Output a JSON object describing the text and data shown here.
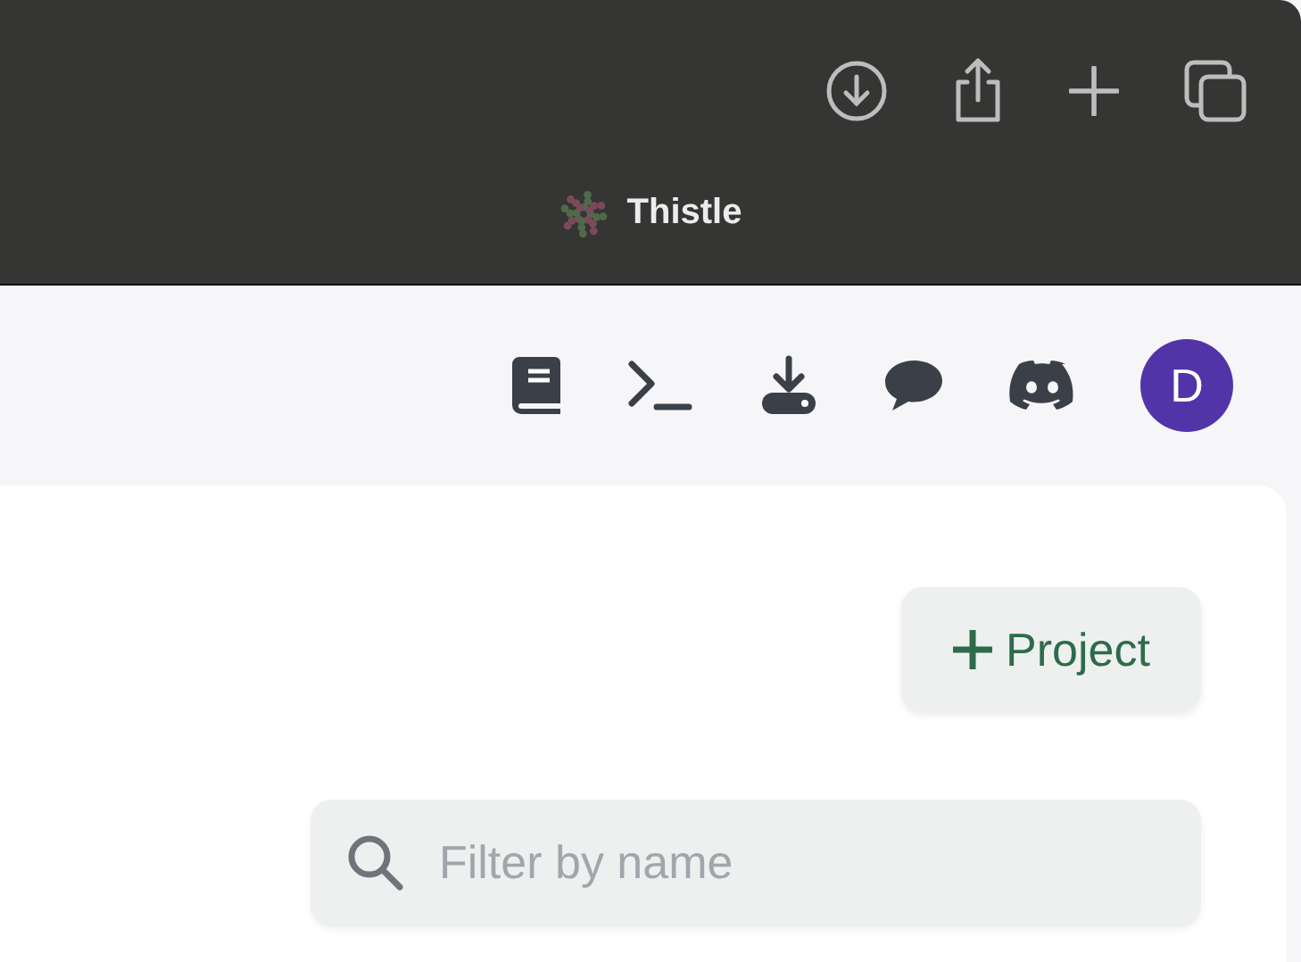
{
  "browser_tab": {
    "title": "Thistle"
  },
  "user": {
    "initial": "D"
  },
  "project_button": {
    "label": "Project"
  },
  "search": {
    "placeholder": "Filter by name"
  }
}
